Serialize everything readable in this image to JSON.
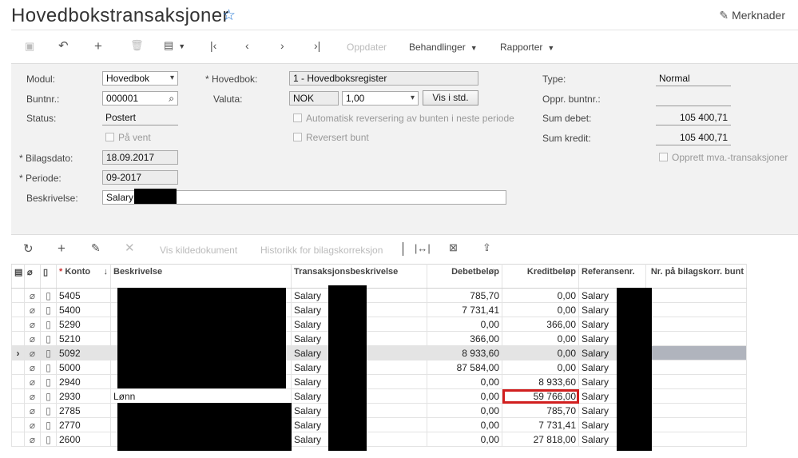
{
  "header": {
    "title": "Hovedbokstransaksjoner",
    "notes_label": "Merknader"
  },
  "toolbar": {
    "update": "Oppdater",
    "actions": "Behandlinger",
    "reports": "Rapporter"
  },
  "form": {
    "module_label": "Modul:",
    "module_value": "Hovedbok",
    "batch_label": "Buntnr.:",
    "batch_value": "000001",
    "status_label": "Status:",
    "status_value": "Postert",
    "hold_label": "På vent",
    "docdate_label": "Bilagsdato:",
    "docdate_value": "18.09.2017",
    "period_label": "Periode:",
    "period_value": "09-2017",
    "desc_label": "Beskrivelse:",
    "desc_value": "Salary",
    "ledger_label": "Hovedbok:",
    "ledger_value": "1 - Hovedboksregister",
    "currency_label": "Valuta:",
    "currency_value": "NOK",
    "rate_value": "1,00",
    "view_base": "Vis i std.",
    "autorev_label": "Automatisk reversering av bunten i neste periode",
    "reversed_label": "Reversert bunt",
    "type_label": "Type:",
    "type_value": "Normal",
    "origbatch_label": "Oppr. buntnr.:",
    "origbatch_value": "",
    "debit_label": "Sum debet:",
    "debit_value": "105 400,71",
    "credit_label": "Sum kredit:",
    "credit_value": "105 400,71",
    "vat_label": "Opprett mva.-transaksjoner"
  },
  "grid_toolbar": {
    "view_source": "Vis kildedokument",
    "history": "Historikk for bilagskorreksjon"
  },
  "grid": {
    "columns": {
      "account": "Konto",
      "description": "Beskrivelse",
      "tran_desc": "Transaksjonsbeskrivelse",
      "debit": "Debetbeløp",
      "credit": "Kreditbeløp",
      "ref": "Referansenr.",
      "corr": "Nr. på bilagskorr. bunt"
    },
    "rows": [
      {
        "account": "5405",
        "description": "",
        "tran_desc": "Salary",
        "debit": "785,70",
        "credit": "0,00",
        "ref": "Salary"
      },
      {
        "account": "5400",
        "description": "",
        "tran_desc": "Salary",
        "debit": "7 731,41",
        "credit": "0,00",
        "ref": "Salary"
      },
      {
        "account": "5290",
        "description": "",
        "tran_desc": "Salary",
        "debit": "0,00",
        "credit": "366,00",
        "ref": "Salary"
      },
      {
        "account": "5210",
        "description": "",
        "tran_desc": "Salary",
        "debit": "366,00",
        "credit": "0,00",
        "ref": "Salary"
      },
      {
        "account": "5092",
        "description": "",
        "tran_desc": "Salary",
        "debit": "8 933,60",
        "credit": "0,00",
        "ref": "Salary"
      },
      {
        "account": "5000",
        "description": "",
        "tran_desc": "Salary",
        "debit": "87 584,00",
        "credit": "0,00",
        "ref": "Salary"
      },
      {
        "account": "2940",
        "description": "",
        "tran_desc": "Salary",
        "debit": "0,00",
        "credit": "8 933,60",
        "ref": "Salary"
      },
      {
        "account": "2930",
        "description": "Lønn",
        "tran_desc": "Salary",
        "debit": "0,00",
        "credit": "59 766,00",
        "ref": "Salary"
      },
      {
        "account": "2785",
        "description": "",
        "tran_desc": "Salary",
        "debit": "0,00",
        "credit": "785,70",
        "ref": "Salary"
      },
      {
        "account": "2770",
        "description": "",
        "tran_desc": "Salary",
        "debit": "0,00",
        "credit": "7 731,41",
        "ref": "Salary"
      },
      {
        "account": "2600",
        "description": "",
        "tran_desc": "Salary",
        "debit": "0,00",
        "credit": "27 818,00",
        "ref": "Salary"
      }
    ]
  }
}
